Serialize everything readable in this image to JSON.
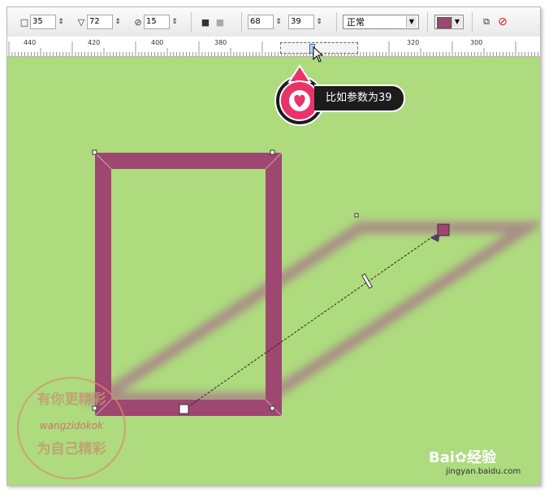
{
  "toolbar": {
    "value_a": "35",
    "value_b": "72",
    "value_c": "15",
    "value_d": "68",
    "value_e": "39",
    "mode": "正常",
    "fill_color": "#9e4770"
  },
  "ruler": {
    "labels": [
      "440",
      "420",
      "400",
      "380",
      "320",
      "300"
    ]
  },
  "callout": {
    "text": "比如参数为39"
  },
  "watermark": {
    "line1": "有你更精彩",
    "line2": "wangzidokok",
    "line3": "为自己精彩"
  },
  "branding": {
    "logo": "Bai",
    "logo_suffix": "经验",
    "url": "jingyan.baidu.com"
  },
  "colors": {
    "canvas": "#addb7e",
    "frame_stroke": "#9e4770",
    "callout_pink": "#e8336b"
  }
}
